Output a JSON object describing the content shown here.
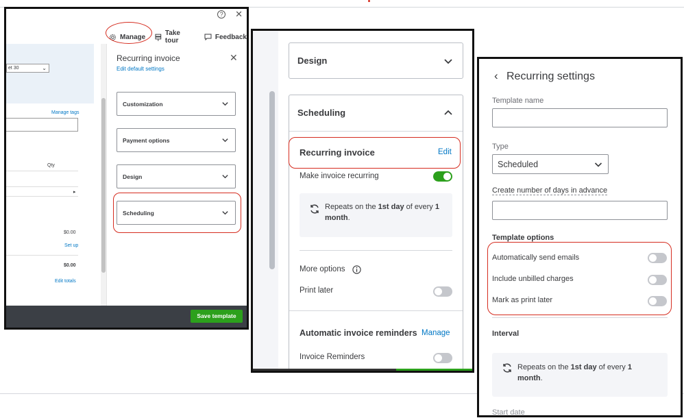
{
  "panel1": {
    "window_icons": {
      "help": "?",
      "close": "✕"
    },
    "toolbar": {
      "manage": "Manage",
      "take_tour": "Take tour",
      "feedback": "Feedback"
    },
    "left": {
      "select_value": "et 30",
      "manage_tags": "Manage tags",
      "qty_header": "Qty",
      "amount1": "$0.00",
      "setup_link": "Set up",
      "amount2": "$0.00",
      "edit_totals": "Edit totals"
    },
    "drawer": {
      "title": "Recurring invoice",
      "subtitle": "Edit default settings",
      "sections": [
        "Customization",
        "Payment options",
        "Design",
        "Scheduling"
      ]
    },
    "footer": {
      "save_label": "Save template"
    }
  },
  "panel2": {
    "design_label": "Design",
    "scheduling_label": "Scheduling",
    "recurring_heading": "Recurring invoice",
    "edit_link": "Edit",
    "make_recurring": "Make invoice recurring",
    "repeat": {
      "pre": "Repeats on the ",
      "day": "1st day",
      "mid": " of every ",
      "num": "1",
      "unit": "month",
      "end": "."
    },
    "more_options": "More options",
    "print_later": "Print later",
    "reminders_heading": "Automatic invoice reminders",
    "manage_link": "Manage",
    "invoice_reminders": "Invoice Reminders",
    "toggles": {
      "make_recurring": true,
      "print_later": false,
      "invoice_reminders": false
    }
  },
  "panel3": {
    "title": "Recurring settings",
    "template_name_label": "Template name",
    "template_name_value": "",
    "type_label": "Type",
    "type_value": "Scheduled",
    "days_advance_label": "Create number of days in advance",
    "days_advance_value": "",
    "template_options_heading": "Template options",
    "options": [
      "Automatically send emails",
      "Include unbilled charges",
      "Mark as print later"
    ],
    "options_state": [
      false,
      false,
      false
    ],
    "interval_heading": "Interval",
    "repeat": {
      "pre": "Repeats on the ",
      "day": "1st day",
      "mid": " of every ",
      "num": "1",
      "unit": "month",
      "end": "."
    },
    "start_date_label": "Start date"
  },
  "colors": {
    "accent_green": "#2ca01c",
    "link_blue": "#0077c5",
    "highlight_red": "#d52b1e",
    "text": "#393a3d"
  }
}
